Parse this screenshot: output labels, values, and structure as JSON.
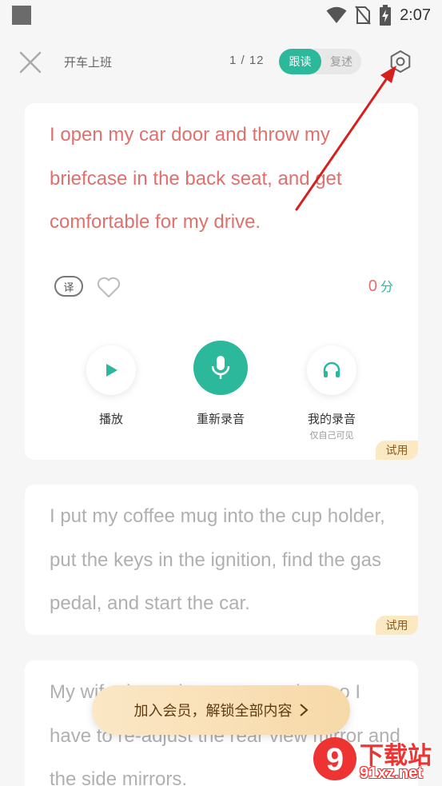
{
  "status_bar": {
    "time": "2:07",
    "icons": [
      "wifi-icon",
      "no-sim-icon",
      "battery-charging-icon"
    ]
  },
  "header": {
    "title": "开车上班",
    "page_indicator": "1 / 12",
    "mode_active": "跟读",
    "mode_inactive": "复述"
  },
  "cards": [
    {
      "sentence": "I open my car door and throw my briefcase in the back seat, and get comfortable for my drive.",
      "translate_label": "译",
      "score_value": "0",
      "score_unit": "分",
      "play_label": "播放",
      "record_label": "重新录音",
      "my_recording_label": "我的录音",
      "my_recording_sub": "仅自己可见",
      "trial_badge": "试用"
    },
    {
      "sentence": "I put my coffee mug into the cup holder, put the keys in the ignition, find the gas pedal, and start the car.",
      "trial_badge": "试用"
    },
    {
      "sentence": "My wife drove the car yesterday, so I have to re-adjust the rear view mirror and the side mirrors."
    }
  ],
  "member_banner": {
    "label": "加入会员，解锁全部内容"
  },
  "watermark": {
    "mark": "9",
    "text1": "下载站",
    "text2": "91xz.net"
  },
  "colors": {
    "accent": "#2bb89b",
    "highlight_text": "#e0706d",
    "inactive_text": "#b0b0b0",
    "trial_badge_bg": "#fbe9c4",
    "annotation_arrow": "#d62020"
  }
}
